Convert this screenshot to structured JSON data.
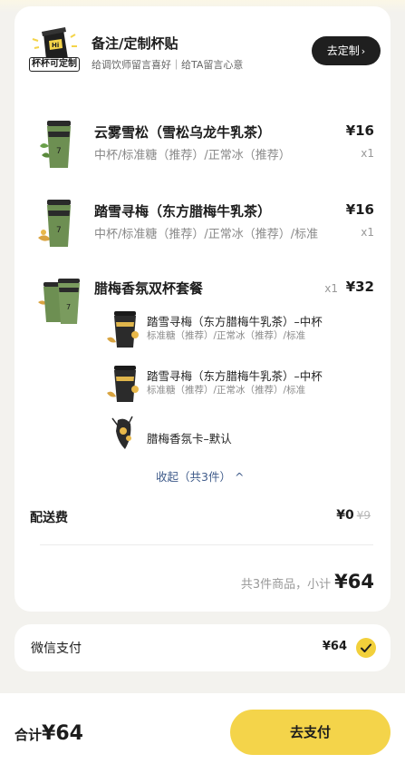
{
  "custom": {
    "title": "备注/定制杯贴",
    "subtitle": "给调饮师留言喜好｜给TA留言心意",
    "logo_tag": "杯杯可定制",
    "button": "去定制"
  },
  "items": [
    {
      "name": "云雾雪松（雪松乌龙牛乳茶）",
      "spec": "中杯/标准糖（推荐）/正常冰（推荐）",
      "price": "¥16",
      "qty": "x1",
      "thumb_icon": "green-tea-cup-icon"
    },
    {
      "name": "踏雪寻梅（东方腊梅牛乳茶）",
      "spec": "中杯/标准糖（推荐）/正常冰（推荐）/标准",
      "price": "¥16",
      "qty": "x1",
      "thumb_icon": "green-tea-cup-icon"
    }
  ],
  "set_meal": {
    "name": "腊梅香氛双杯套餐",
    "qty": "x1",
    "price": "¥32",
    "thumb_icon": "double-cup-icon",
    "components": [
      {
        "name": "踏雪寻梅（东方腊梅牛乳茶）–中杯",
        "spec": "标准糖（推荐）/正常冰（推荐）/标准",
        "thumb_icon": "black-tea-cup-icon"
      },
      {
        "name": "踏雪寻梅（东方腊梅牛乳茶）–中杯",
        "spec": "标准糖（推荐）/正常冰（推荐）/标准",
        "thumb_icon": "black-tea-cup-icon"
      },
      {
        "name": "腊梅香氛卡–默认",
        "spec": "",
        "thumb_icon": "plum-card-icon"
      }
    ],
    "collapse": "收起（共3件）"
  },
  "delivery": {
    "label": "配送费",
    "price": "¥0",
    "original": "¥9"
  },
  "summary": {
    "text": "共3件商品，小计",
    "total": "¥64"
  },
  "payment": {
    "label": "微信支付",
    "amount": "¥64",
    "icon": "check-icon"
  },
  "footer": {
    "total_label": "合计",
    "total_amount": "¥64",
    "pay_button": "去支付"
  },
  "colors": {
    "accent": "#f4d44a",
    "link": "#3f5b8a",
    "dark_button": "#1f1f1f"
  }
}
